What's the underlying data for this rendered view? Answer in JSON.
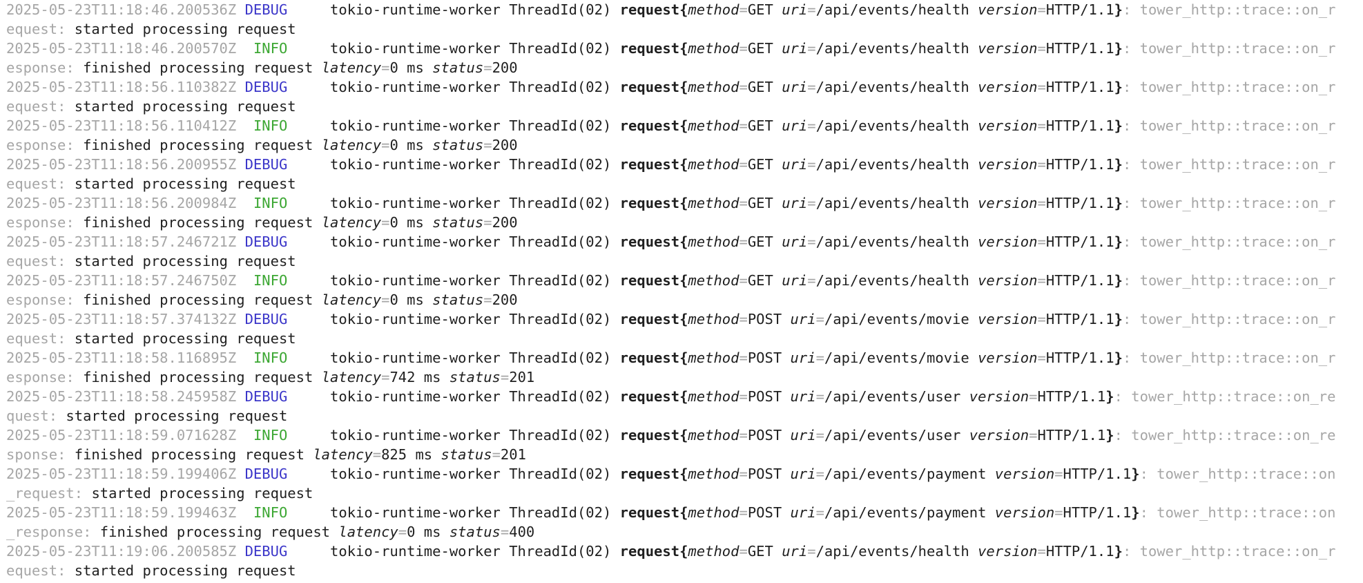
{
  "window": {
    "title": ""
  },
  "log": {
    "entries": [
      {
        "timestamp": "2025-05-23T11:18:46.200536Z",
        "level": "DEBUG",
        "thread": "tokio-runtime-worker ThreadId(02)",
        "span": "request",
        "method": "GET",
        "uri": "/api/events/health",
        "version": "HTTP/1.1",
        "target": "tower_http::trace::on_request",
        "message": "started processing request",
        "latency": null,
        "status": null
      },
      {
        "timestamp": "2025-05-23T11:18:46.200570Z",
        "level": "INFO",
        "thread": "tokio-runtime-worker ThreadId(02)",
        "span": "request",
        "method": "GET",
        "uri": "/api/events/health",
        "version": "HTTP/1.1",
        "target": "tower_http::trace::on_response",
        "message": "finished processing request",
        "latency": "0 ms",
        "status": "200"
      },
      {
        "timestamp": "2025-05-23T11:18:56.110382Z",
        "level": "DEBUG",
        "thread": "tokio-runtime-worker ThreadId(02)",
        "span": "request",
        "method": "GET",
        "uri": "/api/events/health",
        "version": "HTTP/1.1",
        "target": "tower_http::trace::on_request",
        "message": "started processing request",
        "latency": null,
        "status": null
      },
      {
        "timestamp": "2025-05-23T11:18:56.110412Z",
        "level": "INFO",
        "thread": "tokio-runtime-worker ThreadId(02)",
        "span": "request",
        "method": "GET",
        "uri": "/api/events/health",
        "version": "HTTP/1.1",
        "target": "tower_http::trace::on_response",
        "message": "finished processing request",
        "latency": "0 ms",
        "status": "200"
      },
      {
        "timestamp": "2025-05-23T11:18:56.200955Z",
        "level": "DEBUG",
        "thread": "tokio-runtime-worker ThreadId(02)",
        "span": "request",
        "method": "GET",
        "uri": "/api/events/health",
        "version": "HTTP/1.1",
        "target": "tower_http::trace::on_request",
        "message": "started processing request",
        "latency": null,
        "status": null
      },
      {
        "timestamp": "2025-05-23T11:18:56.200984Z",
        "level": "INFO",
        "thread": "tokio-runtime-worker ThreadId(02)",
        "span": "request",
        "method": "GET",
        "uri": "/api/events/health",
        "version": "HTTP/1.1",
        "target": "tower_http::trace::on_response",
        "message": "finished processing request",
        "latency": "0 ms",
        "status": "200"
      },
      {
        "timestamp": "2025-05-23T11:18:57.246721Z",
        "level": "DEBUG",
        "thread": "tokio-runtime-worker ThreadId(02)",
        "span": "request",
        "method": "GET",
        "uri": "/api/events/health",
        "version": "HTTP/1.1",
        "target": "tower_http::trace::on_request",
        "message": "started processing request",
        "latency": null,
        "status": null
      },
      {
        "timestamp": "2025-05-23T11:18:57.246750Z",
        "level": "INFO",
        "thread": "tokio-runtime-worker ThreadId(02)",
        "span": "request",
        "method": "GET",
        "uri": "/api/events/health",
        "version": "HTTP/1.1",
        "target": "tower_http::trace::on_response",
        "message": "finished processing request",
        "latency": "0 ms",
        "status": "200"
      },
      {
        "timestamp": "2025-05-23T11:18:57.374132Z",
        "level": "DEBUG",
        "thread": "tokio-runtime-worker ThreadId(02)",
        "span": "request",
        "method": "POST",
        "uri": "/api/events/movie",
        "version": "HTTP/1.1",
        "target": "tower_http::trace::on_request",
        "message": "started processing request",
        "latency": null,
        "status": null
      },
      {
        "timestamp": "2025-05-23T11:18:58.116895Z",
        "level": "INFO",
        "thread": "tokio-runtime-worker ThreadId(02)",
        "span": "request",
        "method": "POST",
        "uri": "/api/events/movie",
        "version": "HTTP/1.1",
        "target": "tower_http::trace::on_response",
        "message": "finished processing request",
        "latency": "742 ms",
        "status": "201"
      },
      {
        "timestamp": "2025-05-23T11:18:58.245958Z",
        "level": "DEBUG",
        "thread": "tokio-runtime-worker ThreadId(02)",
        "span": "request",
        "method": "POST",
        "uri": "/api/events/user",
        "version": "HTTP/1.1",
        "target": "tower_http::trace::on_request",
        "message": "started processing request",
        "latency": null,
        "status": null
      },
      {
        "timestamp": "2025-05-23T11:18:59.071628Z",
        "level": "INFO",
        "thread": "tokio-runtime-worker ThreadId(02)",
        "span": "request",
        "method": "POST",
        "uri": "/api/events/user",
        "version": "HTTP/1.1",
        "target": "tower_http::trace::on_response",
        "message": "finished processing request",
        "latency": "825 ms",
        "status": "201"
      },
      {
        "timestamp": "2025-05-23T11:18:59.199406Z",
        "level": "DEBUG",
        "thread": "tokio-runtime-worker ThreadId(02)",
        "span": "request",
        "method": "POST",
        "uri": "/api/events/payment",
        "version": "HTTP/1.1",
        "target": "tower_http::trace::on_request",
        "message": "started processing request",
        "latency": null,
        "status": null
      },
      {
        "timestamp": "2025-05-23T11:18:59.199463Z",
        "level": "INFO",
        "thread": "tokio-runtime-worker ThreadId(02)",
        "span": "request",
        "method": "POST",
        "uri": "/api/events/payment",
        "version": "HTTP/1.1",
        "target": "tower_http::trace::on_response",
        "message": "finished processing request",
        "latency": "0 ms",
        "status": "400"
      },
      {
        "timestamp": "2025-05-23T11:19:06.200585Z",
        "level": "DEBUG",
        "thread": "tokio-runtime-worker ThreadId(02)",
        "span": "request",
        "method": "GET",
        "uri": "/api/events/health",
        "version": "HTTP/1.1",
        "target": "tower_http::trace::on_request",
        "message": "started processing request",
        "latency": null,
        "status": null
      }
    ]
  },
  "labels": {
    "method_key": "method",
    "uri_key": "uri",
    "version_key": "version",
    "latency_key": "latency",
    "status_key": "status"
  },
  "colors": {
    "debug": "#3b36c9",
    "info": "#3ca733",
    "dim": "#a6a6a6",
    "text": "#1f1f1f",
    "background": "#ffffff"
  }
}
